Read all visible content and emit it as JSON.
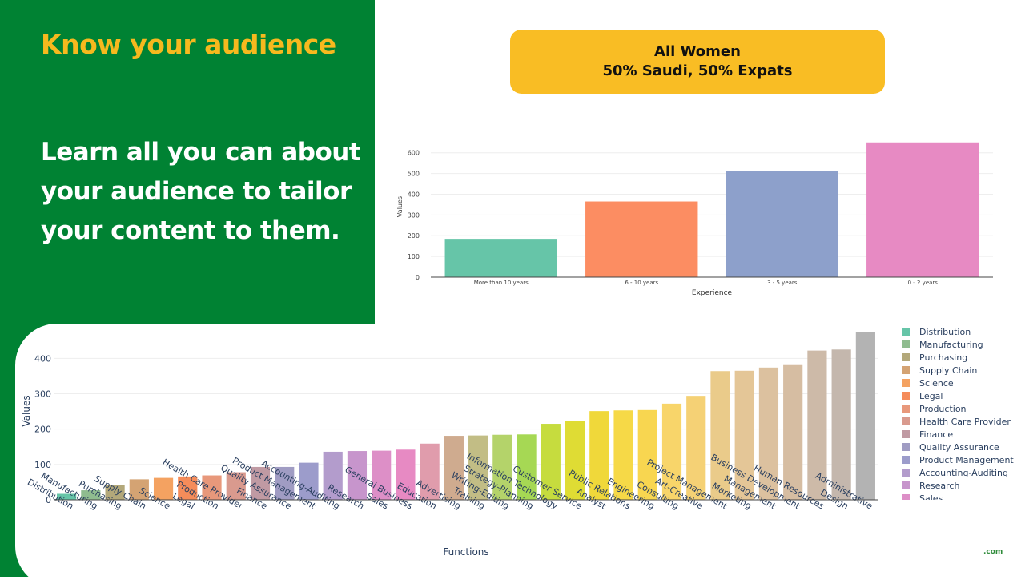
{
  "slide": {
    "heading": "Know your audience",
    "body": "Learn all you can about your audience to tailor your content to them.",
    "callout_line1": "All Women",
    "callout_line2": "50% Saudi, 50% Expats",
    "logo_text": ".com"
  },
  "colors": {
    "panel": "#008233",
    "heading": "#f6b91e",
    "callout": "#f9bd24"
  },
  "chart_data": [
    {
      "type": "bar",
      "categories": [
        "More than 10 years",
        "6 - 10 years",
        "3 - 5 years",
        "0 - 2 years"
      ],
      "values": [
        185,
        365,
        513,
        650
      ],
      "colors": [
        "#66c5a8",
        "#fc8d62",
        "#8da0cb",
        "#e78ac3"
      ],
      "xlabel": "Experience",
      "ylabel": "Values",
      "ylim": [
        0,
        680
      ],
      "yticks": [
        0,
        100,
        200,
        300,
        400,
        500,
        600
      ],
      "grid": true
    },
    {
      "type": "bar",
      "categories": [
        "Distribution",
        "Manufacturing",
        "Purchasing",
        "Supply Chain",
        "Science",
        "Legal",
        "Production",
        "Health Care Provider",
        "Finance",
        "Quality Assurance",
        "Product Management",
        "Accounting-Auditing",
        "Research",
        "Sales",
        "General Business",
        "Education",
        "Advertising",
        "Training",
        "Writing-Editing",
        "Strategy-Planning",
        "Information Technology",
        "Customer Service",
        "Analyst",
        "Public Relations",
        "Engineering",
        "Consulting",
        "Art-Creative",
        "Project Management",
        "Marketing",
        "Management",
        "Business Development",
        "Human Resources",
        "Design",
        "Administrative"
      ],
      "values": [
        17,
        27,
        41,
        58,
        62,
        66,
        69,
        78,
        93,
        93,
        105,
        136,
        138,
        139,
        142,
        159,
        181,
        182,
        184,
        185,
        215,
        224,
        251,
        253,
        254,
        272,
        294,
        364,
        365,
        374,
        381,
        422,
        425,
        475
      ],
      "colors": [
        "#66c5a8",
        "#8fbc8f",
        "#b3a87a",
        "#d4a373",
        "#f4a261",
        "#f58c5a",
        "#e8987b",
        "#d99a8e",
        "#c09aa3",
        "#a09cc3",
        "#9c9ccb",
        "#b39ccc",
        "#c795cc",
        "#dd8fc7",
        "#e78ac3",
        "#e09cac",
        "#cfab8f",
        "#c2bd85",
        "#b4d36a",
        "#a6d854",
        "#c6dc3e",
        "#dfdc34",
        "#f0d83a",
        "#f6d947",
        "#f8d650",
        "#f8d56a",
        "#f5d175",
        "#eacb8a",
        "#e4c697",
        "#dcc19f",
        "#d6bda2",
        "#cdbaa8",
        "#c4b7ad",
        "#b3b3b3"
      ],
      "xlabel": "Functions",
      "ylabel": "Values",
      "ylim": [
        0,
        480
      ],
      "yticks": [
        0,
        100,
        200,
        300,
        400
      ],
      "grid": true,
      "legend_position": "right",
      "legend_visible_count": 14
    }
  ]
}
